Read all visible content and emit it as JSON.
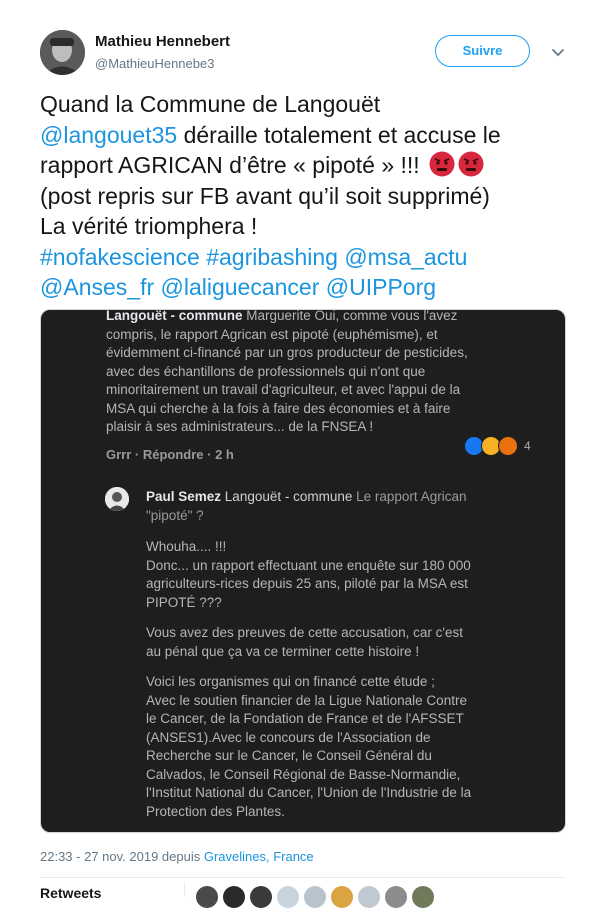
{
  "header": {
    "name": "Mathieu Hennebert",
    "handle": "@MathieuHennebe3",
    "follow_label": "Suivre"
  },
  "tweet": {
    "line1": "Quand la Commune de Langouët",
    "line2_link": "@langouet35",
    "line2_text": " déraille totalement et accuse le",
    "line3": "rapport AGRICAN d’être « pipoté » !!! ",
    "line4": "(post repris sur FB avant qu’il soit supprimé)",
    "line5": "La vérité triomphera !",
    "line6": "#nofakescience #agribashing @msa_actu",
    "line7": "@Anses_fr @laliguecancer @UIPPorg"
  },
  "screenshot": {
    "comment1_name": "Langouët - commune",
    "comment1_lines": [
      " Marguerite Oui, comme vous l'avez",
      "compris, le rapport Agrican est pipoté (euphémisme), et",
      "évidemment ci-financé par un gros producteur de pesticides,",
      "avec des échantillons de professionnels qui n'ont que",
      "minoritairement un travail d'agriculteur, et avec l'appui de la",
      "MSA qui cherche à la fois à faire des économies et à faire",
      "plaisir à ses administrateurs... de la FNSEA !"
    ],
    "actions": "Grrr · Répondre · 2 h",
    "reaction_count": "4",
    "reply_name": "Paul Semez",
    "reply_target": " Langouët - commune",
    "reply_quote1": " Le rapport Agrican",
    "reply_quote2": "\"pipoté\" ?",
    "reply_body": [
      "Whouha.... !!!",
      "Donc... un rapport effectuant une enquête sur 180 000",
      "agriculteurs-rices depuis 25 ans, piloté par la MSA est",
      "PIPOTÉ ???",
      "",
      "Vous avez des preuves de cette accusation, car c'est",
      "au pénal que ça va ce terminer cette histoire !",
      "",
      "Voici les organismes qui on financé cette étude ;",
      "Avec le soutien financier de la Ligue Nationale Contre",
      "le Cancer, de la Fondation de France et de l'AFSSET",
      "(ANSES1).Avec le concours de l'Association de",
      "Recherche sur le Cancer, le Conseil Général du",
      "Calvados, le Conseil Régional de Basse-Normandie,",
      "l'Institut National du Cancer, l'Union de l'Industrie de la",
      "Protection des Plantes."
    ]
  },
  "meta": {
    "timestamp": "22:33 - 27 nov. 2019 depuis ",
    "place": "Gravelines, France"
  },
  "footer": {
    "stats_partial": "Retweets"
  },
  "colors": {
    "link": "#1b95e0",
    "follow": "#1da1f2",
    "fb_bg": "#1e1e1e"
  }
}
